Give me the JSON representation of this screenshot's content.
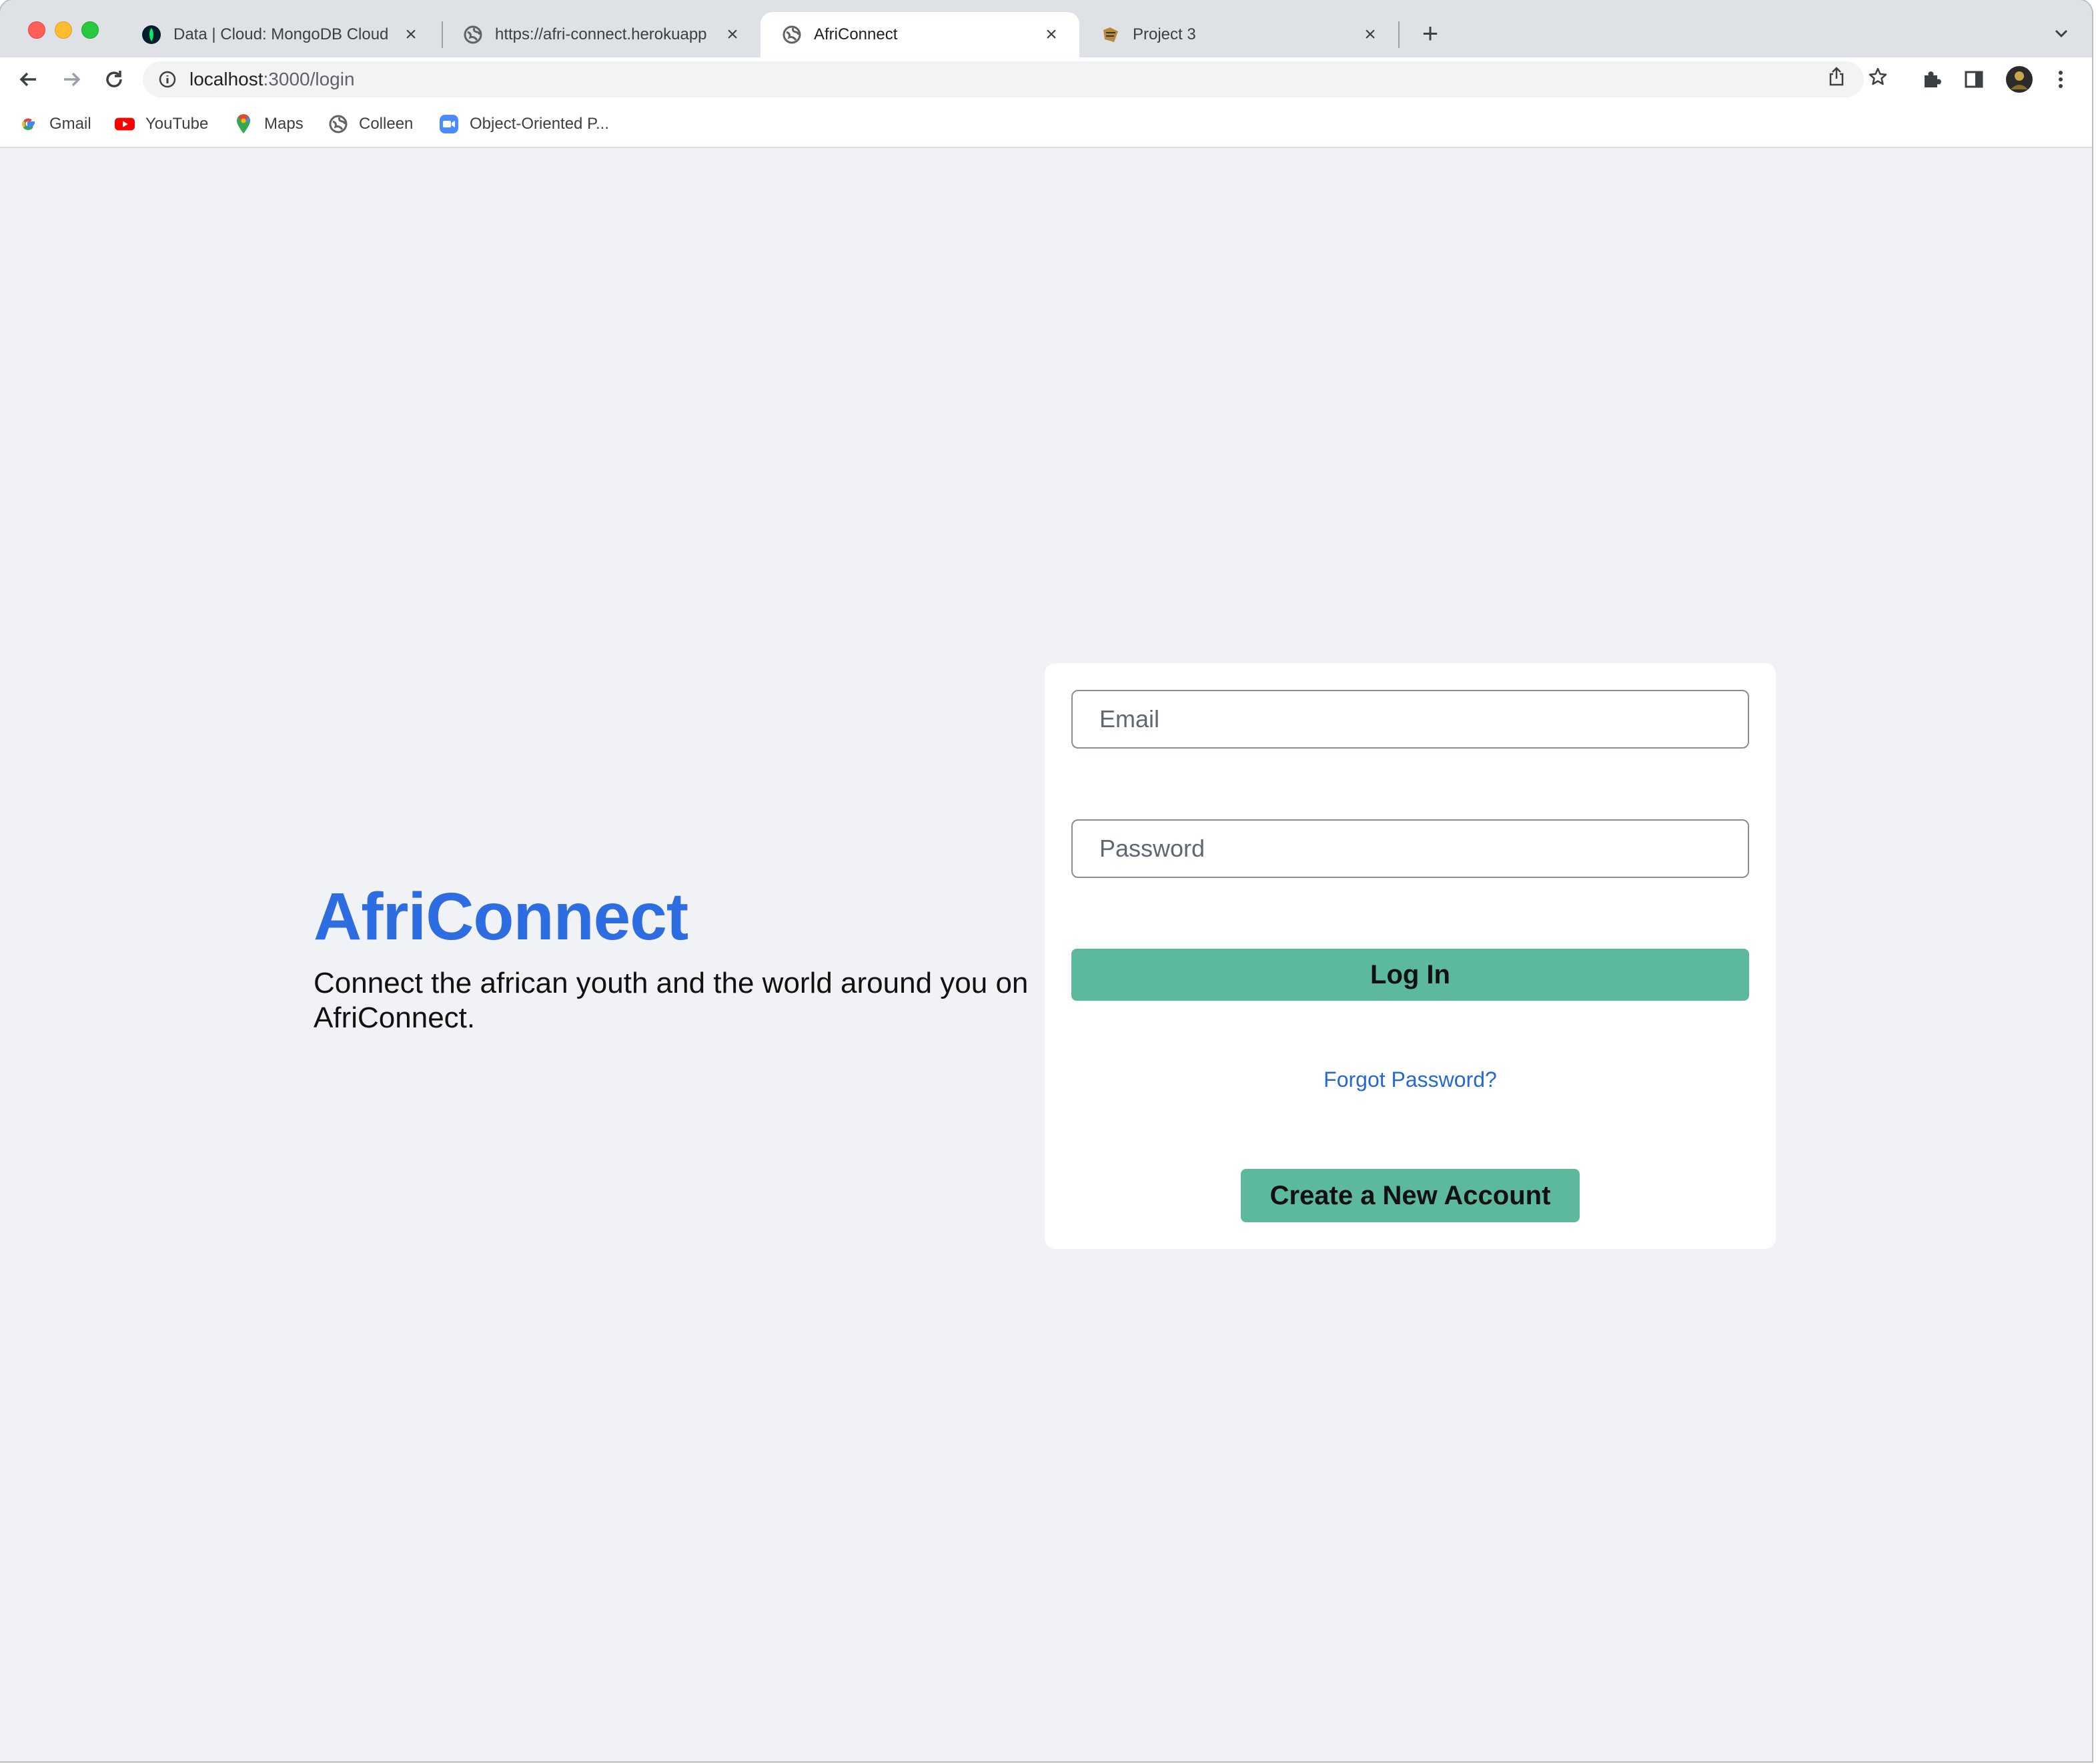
{
  "tabs": [
    {
      "title": "Data | Cloud: MongoDB Cloud",
      "favicon": "mongodb-leaf-icon",
      "active": false
    },
    {
      "title": "https://afri-connect.herokuapp",
      "favicon": "globe-icon",
      "active": false
    },
    {
      "title": "AfriConnect",
      "favicon": "globe-icon",
      "active": true
    },
    {
      "title": "Project 3",
      "favicon": "project-icon",
      "active": false
    }
  ],
  "toolbar": {
    "url_host": "localhost",
    "url_path": ":3000/login"
  },
  "bookmarks": [
    {
      "label": "Gmail",
      "icon": "google-icon"
    },
    {
      "label": "YouTube",
      "icon": "youtube-icon"
    },
    {
      "label": "Maps",
      "icon": "maps-pin-icon"
    },
    {
      "label": "Colleen",
      "icon": "globe-icon"
    },
    {
      "label": "Object-Oriented P...",
      "icon": "zoom-video-icon"
    }
  ],
  "page": {
    "brand": "AfriConnect",
    "tagline": "Connect the african youth and the world around you on AfriConnect.",
    "login_form": {
      "email_placeholder": "Email",
      "email_value": "",
      "password_placeholder": "Password",
      "password_value": "",
      "login_label": "Log In",
      "forgot_label": "Forgot Password?",
      "create_label": "Create a New Account"
    }
  },
  "colors": {
    "brand": "#2d6de1",
    "button": "#5cb99d",
    "link": "#2468d8",
    "background": "#f0f2f5"
  }
}
